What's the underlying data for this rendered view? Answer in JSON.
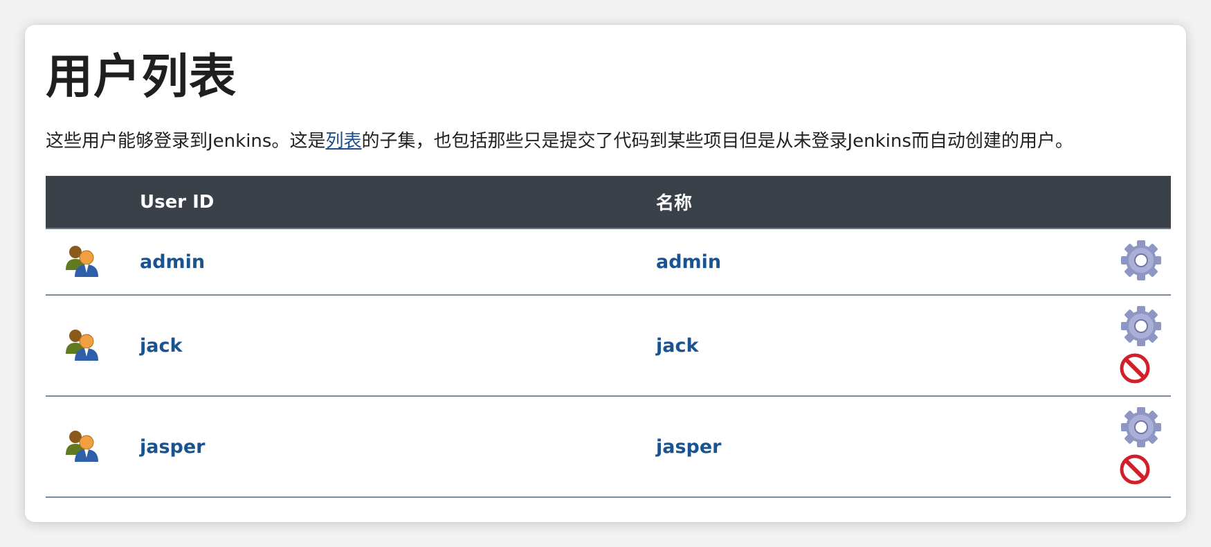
{
  "page": {
    "title": "用户列表",
    "description": {
      "before_link": "这些用户能够登录到Jenkins。这是",
      "link_text": "列表",
      "after_link": "的子集，也包括那些只是提交了代码到某些项目但是从未登录Jenkins而自动创建的用户。"
    }
  },
  "table": {
    "headers": {
      "icon": "",
      "user_id": "User ID",
      "name": "名称",
      "actions": ""
    },
    "rows": [
      {
        "user_id": "admin",
        "name": "admin",
        "icons": [
          "users-icon",
          "gear-icon"
        ]
      },
      {
        "user_id": "jack",
        "name": "jack",
        "icons": [
          "users-icon",
          "gear-icon",
          "delete-icon"
        ]
      },
      {
        "user_id": "jasper",
        "name": "jasper",
        "icons": [
          "users-icon",
          "gear-icon",
          "delete-icon"
        ]
      }
    ]
  },
  "colors": {
    "header_bg": "#3b4149",
    "link": "#1a5490",
    "row_divider": "#7a8a99",
    "delete_red": "#d0202a"
  }
}
